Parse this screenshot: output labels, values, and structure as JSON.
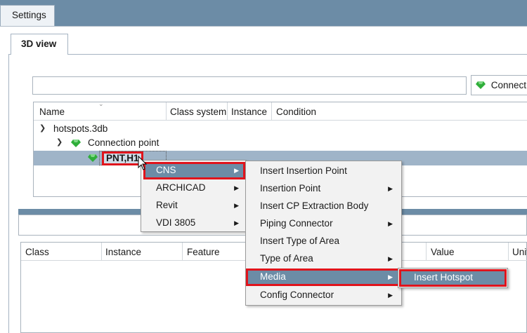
{
  "window": {
    "title": "Settings"
  },
  "tabs": {
    "active": "3D view"
  },
  "filter": {
    "value": "",
    "placeholder": ""
  },
  "toolbar": {
    "connect_label": "Connect"
  },
  "tree": {
    "columns": [
      "Name",
      "Class system",
      "Instance",
      "Condition"
    ],
    "nodes": [
      {
        "label": "hotspots.3db",
        "level": 0,
        "expanded": true
      },
      {
        "label": "Connection point",
        "level": 1,
        "expanded": true
      },
      {
        "label": "PNT,H1",
        "level": 2,
        "selected": true
      }
    ]
  },
  "table": {
    "columns": [
      "Class",
      "Instance",
      "Feature",
      "Value",
      "Unit"
    ]
  },
  "context_menu": {
    "items": [
      {
        "label": "CNS",
        "submenu": true,
        "highlighted": true
      },
      {
        "label": "ARCHICAD",
        "submenu": true
      },
      {
        "label": "Revit",
        "submenu": true
      },
      {
        "label": "VDI 3805",
        "submenu": true
      }
    ]
  },
  "cns_submenu": {
    "items": [
      {
        "label": "Insert Insertion Point",
        "submenu": false
      },
      {
        "label": "Insertion Point",
        "submenu": true
      },
      {
        "label": "Insert CP Extraction Body",
        "submenu": false
      },
      {
        "label": "Piping Connector",
        "submenu": true
      },
      {
        "label": "Insert Type of Area",
        "submenu": false
      },
      {
        "label": "Type of Area",
        "submenu": true
      },
      {
        "label": "Media",
        "submenu": true,
        "highlighted": true
      },
      {
        "label": "Config Connector",
        "submenu": true
      }
    ]
  },
  "media_submenu": {
    "items": [
      {
        "label": "Insert Hotspot",
        "highlighted": true
      }
    ]
  },
  "icons": {
    "connection_point": "green-gem-icon",
    "expand": "chevron-down-icon",
    "submenu": "triangle-right-icon",
    "cursor": "mouse-pointer-icon"
  },
  "colors": {
    "accent": "#6c8ca6",
    "selection": "#9fb4c8",
    "highlight_border": "#e0141c",
    "gem": "#2fae3a"
  }
}
